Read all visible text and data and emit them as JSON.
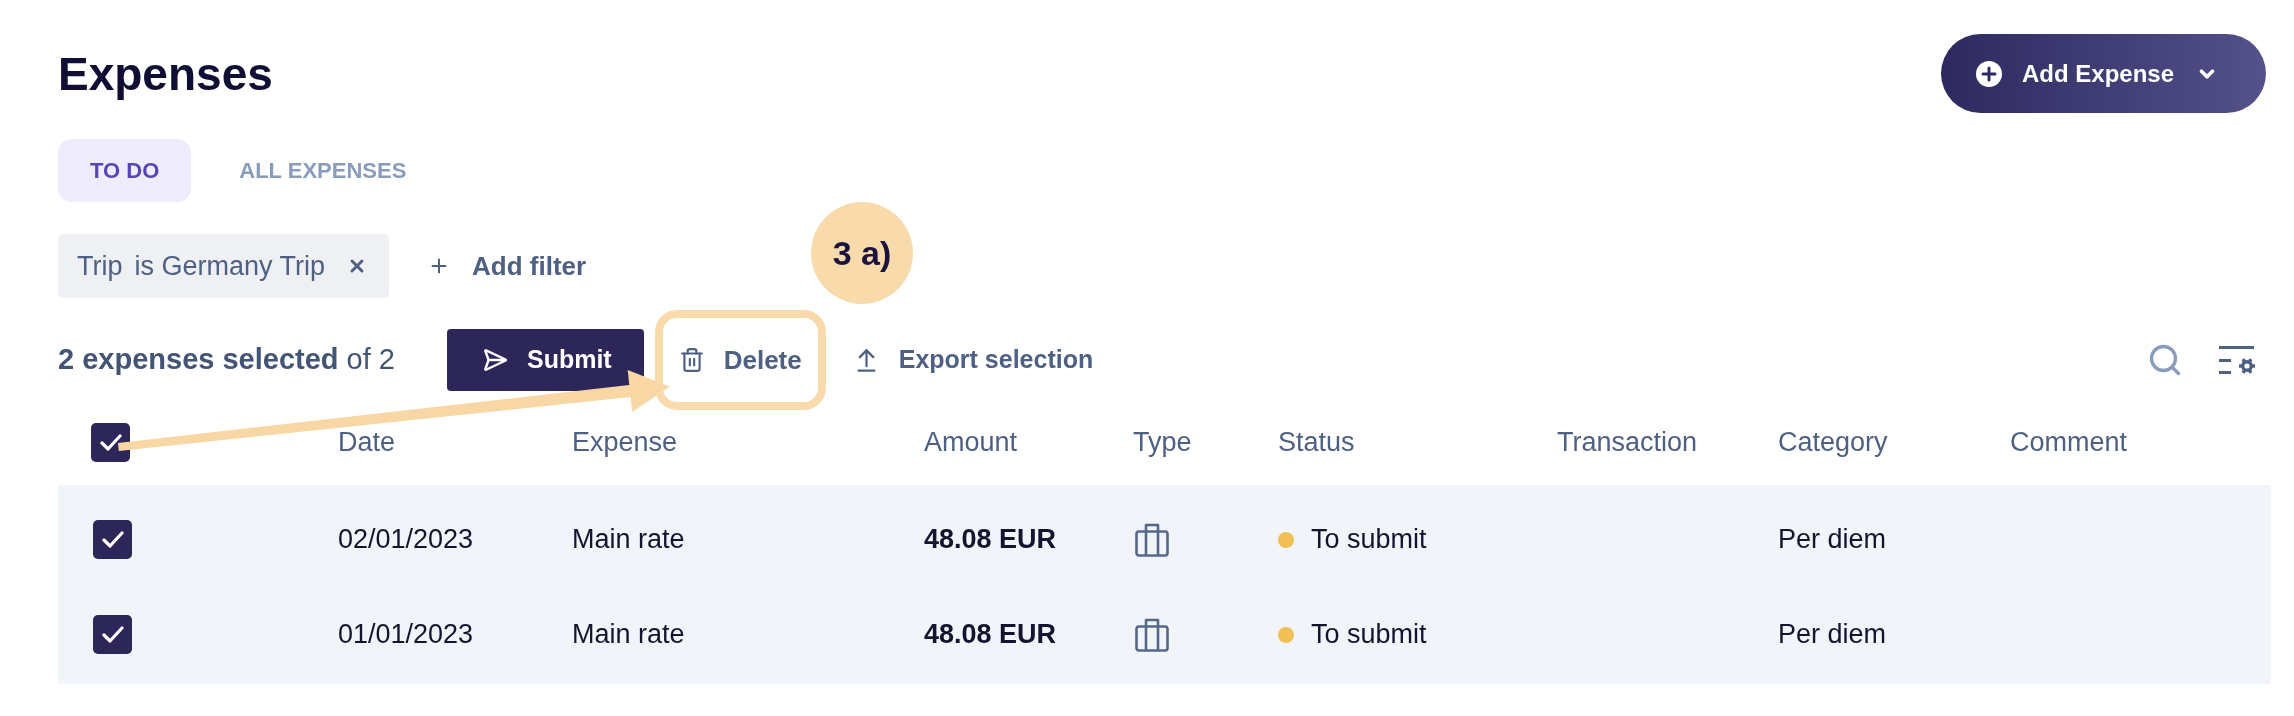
{
  "page": {
    "title": "Expenses"
  },
  "add_expense_button": {
    "label": "Add Expense"
  },
  "tabs": [
    {
      "label": "TO DO",
      "selected": true
    },
    {
      "label": "ALL EXPENSES",
      "selected": false
    }
  ],
  "filters": [
    {
      "field": "Trip",
      "condition": "is Germany Trip"
    }
  ],
  "add_filter": {
    "label": "Add filter"
  },
  "selection_summary": "**2 expenses selected** of 2",
  "actions": [
    {
      "kind": "submit",
      "label": "Submit",
      "highlighted": false
    },
    {
      "kind": "delete",
      "label": "Delete",
      "highlighted": true
    },
    {
      "kind": "export",
      "label": "Export selection",
      "highlighted": false
    }
  ],
  "callout": {
    "label": "3 a)"
  },
  "table": {
    "select_all": {
      "checked": true
    },
    "columns": [
      "Date",
      "Expense",
      "Amount",
      "Type",
      "Status",
      "Transaction",
      "Category",
      "Comment"
    ],
    "rows": [
      {
        "checked": true,
        "date": "02/01/2023",
        "expense": "Main rate",
        "amount": "48.08 EUR",
        "status": {
          "label": "To submit",
          "color": "#f0bf55"
        },
        "category": "Per diem"
      },
      {
        "checked": true,
        "date": "01/01/2023",
        "expense": "Main rate",
        "amount": "48.08 EUR",
        "status": {
          "label": "To submit",
          "color": "#f0bf55"
        },
        "category": "Per diem"
      }
    ]
  }
}
